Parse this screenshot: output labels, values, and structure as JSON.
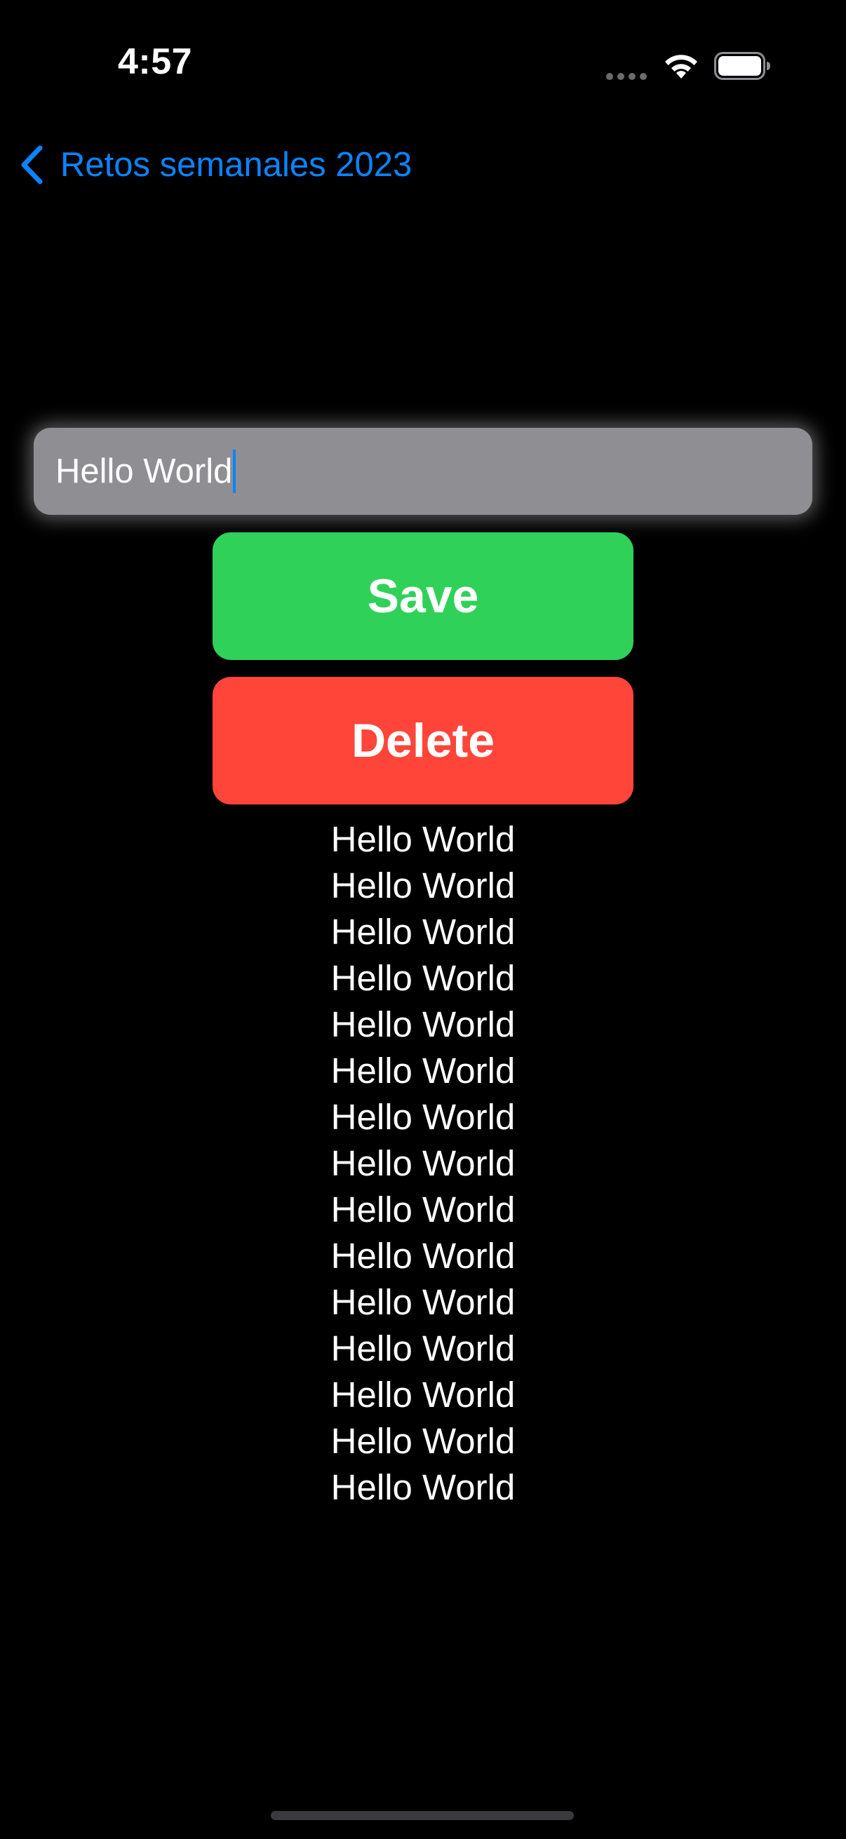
{
  "status_bar": {
    "time": "4:57",
    "icons": [
      "cellular-signal-icon",
      "wifi-icon",
      "battery-icon"
    ]
  },
  "nav": {
    "back_label": "Retos semanales 2023",
    "back_icon": "chevron-left-icon",
    "accent_color": "#0a84ff"
  },
  "text_field": {
    "value": "Hello World"
  },
  "buttons": {
    "save_label": "Save",
    "save_color": "#30d158",
    "delete_label": "Delete",
    "delete_color": "#ff453a"
  },
  "list": {
    "items": [
      "Hello World",
      "Hello World",
      "Hello World",
      "Hello World",
      "Hello World",
      "Hello World",
      "Hello World",
      "Hello World",
      "Hello World",
      "Hello World",
      "Hello World",
      "Hello World",
      "Hello World",
      "Hello World",
      "Hello World"
    ]
  }
}
